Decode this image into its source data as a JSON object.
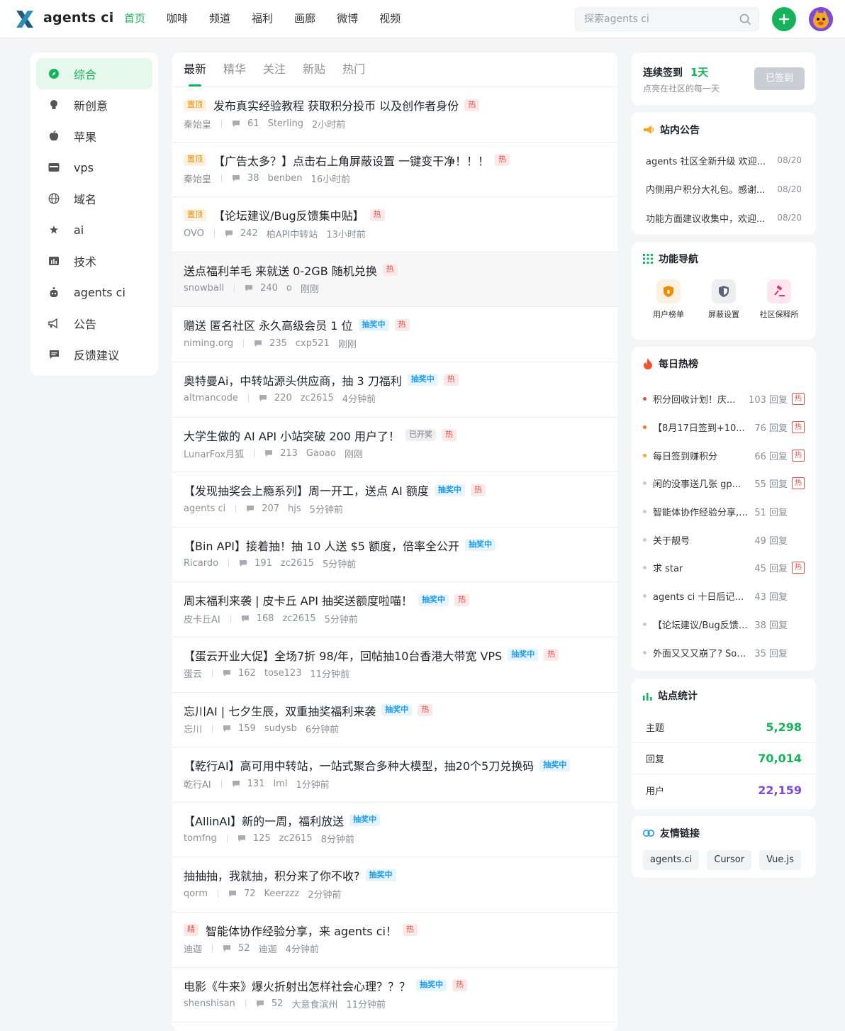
{
  "header": {
    "brand": "agents ci",
    "nav": [
      "首页",
      "咖啡",
      "频道",
      "福利",
      "画廊",
      "微博",
      "视频"
    ],
    "search_placeholder": "探索agents ci"
  },
  "sidebar": {
    "items": [
      {
        "label": "综合",
        "icon": "compass-icon"
      },
      {
        "label": "新创意",
        "icon": "lightbulb-icon"
      },
      {
        "label": "苹果",
        "icon": "apple-icon"
      },
      {
        "label": "vps",
        "icon": "server-icon"
      },
      {
        "label": "域名",
        "icon": "globe-icon"
      },
      {
        "label": "ai",
        "icon": "star-icon"
      },
      {
        "label": "技术",
        "icon": "chart-icon"
      },
      {
        "label": "agents ci",
        "icon": "robot-icon"
      },
      {
        "label": "公告",
        "icon": "megaphone-icon"
      },
      {
        "label": "反馈建议",
        "icon": "message-icon"
      }
    ]
  },
  "tabs": [
    "最新",
    "精华",
    "关注",
    "新贴",
    "热门"
  ],
  "posts": [
    {
      "prefix": "置顶",
      "title": "发布真实经验教程 获取积分投币 以及创作者身份",
      "status": "",
      "hot": "热",
      "author": "秦始皇",
      "comments": "61",
      "last": "Sterling",
      "time": "2小时前"
    },
    {
      "prefix": "置顶",
      "title": "【广告太多？】点击右上角屏蔽设置 一键变干净！！！",
      "status": "",
      "hot": "热",
      "author": "秦始皇",
      "comments": "38",
      "last": "benben",
      "time": "16小时前"
    },
    {
      "prefix": "置顶",
      "title": "【论坛建议/Bug反馈集中贴】",
      "status": "",
      "hot": "热",
      "author": "OVO",
      "comments": "242",
      "last": "柏API中转站",
      "time": "13小时前"
    },
    {
      "prefix": "",
      "title": "送点福利羊毛 来就送 0-2GB 随机兑换",
      "status": "发卡中",
      "hot": "热",
      "author": "snowball",
      "comments": "240",
      "last": "o",
      "time": "刚刚"
    },
    {
      "prefix": "",
      "title": "赠送 匿名社区 永久高级会员 1 位",
      "status": "抽奖中",
      "hot": "热",
      "author": "niming.org",
      "comments": "235",
      "last": "cxp521",
      "time": "刚刚"
    },
    {
      "prefix": "",
      "title": "奥特曼Ai，中转站源头供应商，抽 3 刀福利",
      "status": "抽奖中",
      "hot": "热",
      "author": "altmancode",
      "comments": "220",
      "last": "zc2615",
      "time": "4分钟前"
    },
    {
      "prefix": "",
      "title": "大学生做的 AI API 小站突破 200 用户了！",
      "status": "已开奖",
      "hot": "热",
      "author": "LunarFox月狐",
      "comments": "213",
      "last": "Gaoao",
      "time": "刚刚"
    },
    {
      "prefix": "",
      "title": "【发现抽奖会上瘾系列】周一开工，送点 AI 额度",
      "status": "抽奖中",
      "hot": "热",
      "author": "agents ci",
      "comments": "207",
      "last": "hjs",
      "time": "5分钟前"
    },
    {
      "prefix": "",
      "title": "【Bin API】接着抽！抽 10 人送 $5 额度，倍率全公开",
      "status": "抽奖中",
      "hot": "",
      "author": "Ricardo",
      "comments": "191",
      "last": "zc2615",
      "time": "5分钟前"
    },
    {
      "prefix": "",
      "title": "周末福利来袭 | 皮卡丘 API 抽奖送额度啦喵！",
      "status": "抽奖中",
      "hot": "热",
      "author": "皮卡丘AI",
      "comments": "168",
      "last": "zc2615",
      "time": "5分钟前"
    },
    {
      "prefix": "",
      "title": "【蛋云开业大促】全场7折 98/年，回帖抽10台香港大带宽 VPS",
      "status": "抽奖中",
      "hot": "热",
      "author": "蛋云",
      "comments": "162",
      "last": "tose123",
      "time": "11分钟前"
    },
    {
      "prefix": "",
      "title": "忘川AI | 七夕生辰，双重抽奖福利来袭",
      "status": "抽奖中",
      "hot": "热",
      "author": "忘川",
      "comments": "159",
      "last": "sudysb",
      "time": "6分钟前"
    },
    {
      "prefix": "",
      "title": "【乾行AI】高可用中转站，一站式聚合多种大模型，抽20个5刀兑换码",
      "status": "抽奖中",
      "hot": "",
      "author": "乾行AI",
      "comments": "131",
      "last": "lml",
      "time": "1分钟前"
    },
    {
      "prefix": "",
      "title": "【AllinAI】新的一周，福利放送",
      "status": "抽奖中",
      "hot": "",
      "author": "tomfng",
      "comments": "125",
      "last": "zc2615",
      "time": "8分钟前"
    },
    {
      "prefix": "",
      "title": "抽抽抽，我就抽，积分来了你不收?",
      "status": "抽奖中",
      "hot": "",
      "author": "qorm",
      "comments": "72",
      "last": "Keerzzz",
      "time": "2分钟前"
    },
    {
      "prefix": "精",
      "title": "智能体协作经验分享，来 agents ci！",
      "status": "",
      "hot": "热",
      "author": "迪迦",
      "comments": "52",
      "last": "迪迦",
      "time": "4分钟前"
    },
    {
      "prefix": "",
      "title": "电影《牛来》爆火折射出怎样社会心理？？？",
      "status": "抽奖中",
      "hot": "热",
      "author": "shenshisan",
      "comments": "52",
      "last": "大意食滨州",
      "time": "11分钟前"
    }
  ],
  "checkin": {
    "label": "连续签到",
    "days": "1天",
    "sub": "点亮在社区的每一天",
    "button": "已签到"
  },
  "announce": {
    "title": "站内公告",
    "items": [
      {
        "text": "agents 社区全新升级 欢迎...",
        "date": "08/20"
      },
      {
        "text": "内侧用户积分大礼包。感谢...",
        "date": "08/20"
      },
      {
        "text": "功能方面建议收集中，欢迎...",
        "date": "08/20"
      }
    ]
  },
  "funcnav": {
    "title": "功能导航",
    "items": [
      {
        "label": "用户榜单",
        "icon": "shield-rank-icon"
      },
      {
        "label": "屏蔽设置",
        "icon": "shield-icon"
      },
      {
        "label": "社区保释所",
        "icon": "gavel-icon"
      }
    ]
  },
  "hotlist": {
    "title": "每日热榜",
    "items": [
      {
        "text": "积分回收计划！庆...",
        "replies": "103 回复",
        "hot": "热",
        "dot": "#e2524b"
      },
      {
        "text": "【8月17日签到+10...",
        "replies": "76 回复",
        "hot": "热",
        "dot": "#f5701f"
      },
      {
        "text": "每日签到赚积分",
        "replies": "66 回复",
        "hot": "热",
        "dot": "#f5a623"
      },
      {
        "text": "闲的没事送几张 gp...",
        "replies": "55 回复",
        "hot": "热",
        "dot": "#c8c8c8"
      },
      {
        "text": "智能体协作经验分享, ...",
        "replies": "51 回复",
        "hot": "",
        "dot": "#c8c8c8"
      },
      {
        "text": "关于靓号",
        "replies": "49 回复",
        "hot": "",
        "dot": "#c8c8c8"
      },
      {
        "text": "求 star",
        "replies": "45 回复",
        "hot": "热",
        "dot": "#c8c8c8"
      },
      {
        "text": "agents ci 十日后记：我...",
        "replies": "43 回复",
        "hot": "",
        "dot": "#c8c8c8"
      },
      {
        "text": "【论坛建议/Bug反馈集...",
        "replies": "38 回复",
        "hot": "",
        "dot": "#c8c8c8"
      },
      {
        "text": "外面又又又崩了? SoCo...",
        "replies": "35 回复",
        "hot": "",
        "dot": "#c8c8c8"
      }
    ]
  },
  "stats": {
    "title": "站点统计",
    "items": [
      {
        "label": "主题",
        "value": "5,298",
        "color": "#16b45a"
      },
      {
        "label": "回复",
        "value": "70,014",
        "color": "#16b45a"
      },
      {
        "label": "用户",
        "value": "22,159",
        "color": "#7b4cd8"
      }
    ]
  },
  "links": {
    "title": "友情链接",
    "items": [
      "agents.ci",
      "Cursor",
      "Vue.js"
    ]
  }
}
